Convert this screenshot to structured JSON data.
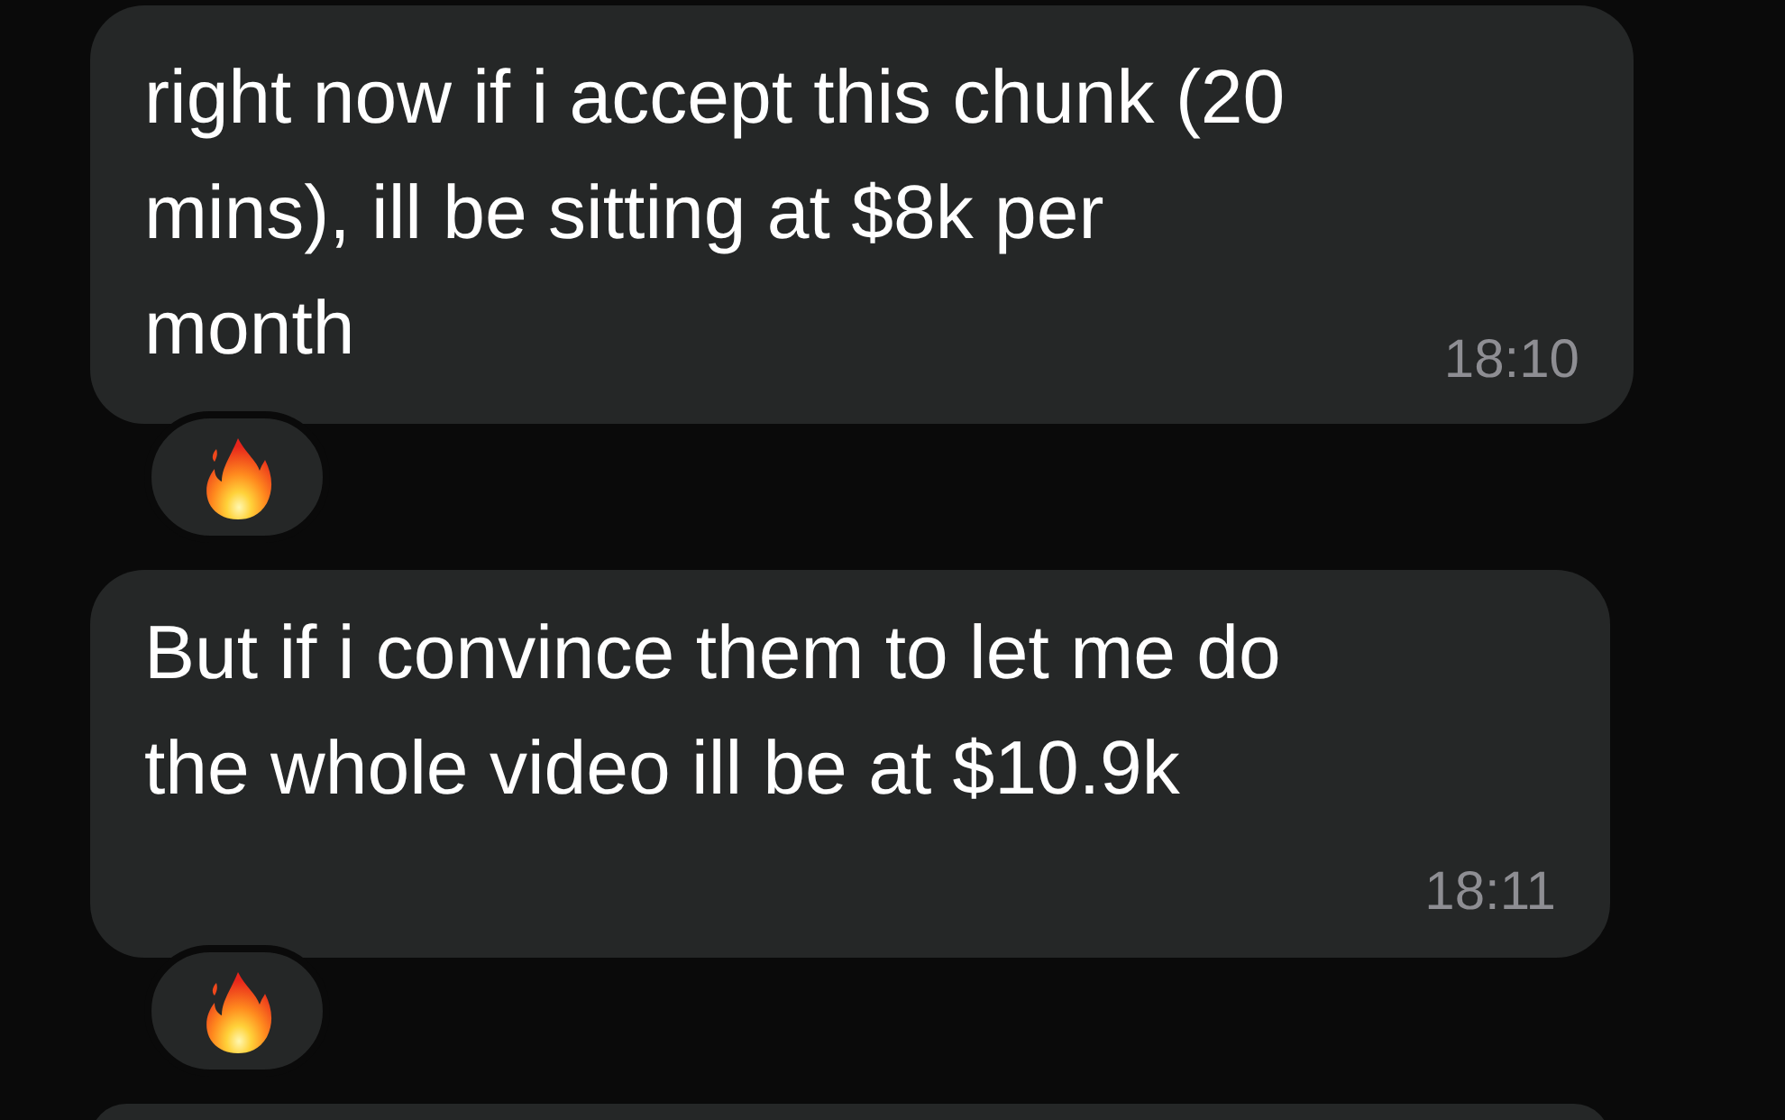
{
  "messages": [
    {
      "text": "right now if i accept this chunk (20\nmins), ill be sitting at $8k per\nmonth",
      "time": "18:10",
      "kind": "short_last_line",
      "reactions": [
        {
          "kind": "fire"
        }
      ]
    },
    {
      "text": "But if i convince them to let me do\nthe whole video ill be at $10.9k",
      "time": "18:11",
      "kind": "long_last_line",
      "reactions": [
        {
          "kind": "fire"
        }
      ]
    },
    {
      "kind": "cut_off"
    }
  ]
}
